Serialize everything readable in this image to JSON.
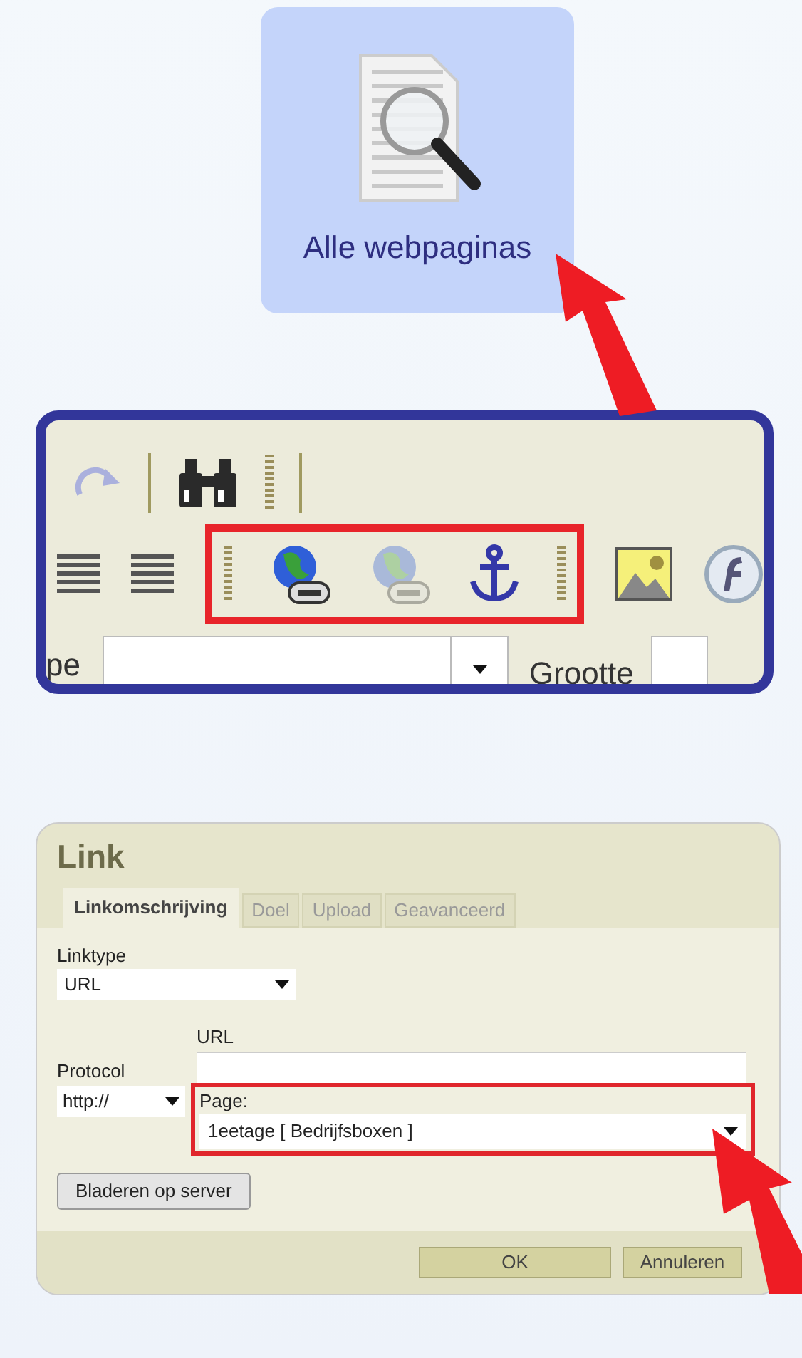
{
  "tile": {
    "label": "Alle webpaginas"
  },
  "toolbar": {
    "top_row": [
      {
        "kind": "redo",
        "disabled": true
      },
      {
        "kind": "separator"
      },
      {
        "kind": "find",
        "disabled": false
      },
      {
        "kind": "grip"
      },
      {
        "kind": "separator"
      }
    ],
    "bottom_row": [
      {
        "kind": "justify"
      },
      {
        "kind": "justify"
      },
      {
        "kind": "grip",
        "highlighted": true
      },
      {
        "kind": "link",
        "disabled": false,
        "highlighted": true
      },
      {
        "kind": "unlink",
        "disabled": true,
        "highlighted": true
      },
      {
        "kind": "anchor",
        "disabled": false,
        "highlighted": true
      },
      {
        "kind": "grip",
        "highlighted": true
      },
      {
        "kind": "image"
      },
      {
        "kind": "flash"
      }
    ],
    "font_label": "pe",
    "size_label": "Grootte"
  },
  "dialog": {
    "title": "Link",
    "tabs": [
      {
        "label": "Linkomschrijving",
        "selected": true
      },
      {
        "label": "Doel",
        "selected": false
      },
      {
        "label": "Upload",
        "selected": false
      },
      {
        "label": "Geavanceerd",
        "selected": false
      }
    ],
    "linktype": {
      "label": "Linktype",
      "value": "URL"
    },
    "url": {
      "label": "URL"
    },
    "protocol": {
      "label": "Protocol",
      "value": "http://"
    },
    "page": {
      "label": "Page:",
      "value": "1eetage [ Bedrijfsboxen ]",
      "highlighted": true
    },
    "browse_button": "Bladeren op server",
    "buttons": [
      "OK",
      "Annuleren"
    ]
  }
}
